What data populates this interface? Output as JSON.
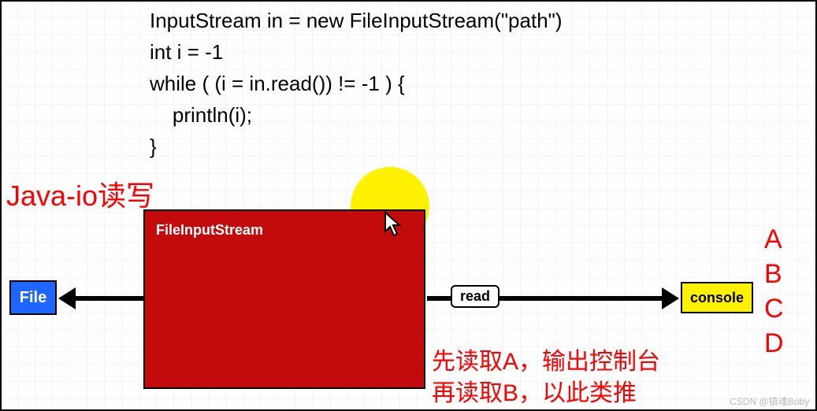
{
  "code": {
    "line1": "InputStream in = new FileInputStream(\"path\")",
    "line2": "int i = -1",
    "line3": "while ( (i = in.read()) != -1 ) {",
    "line4": "    println(i);",
    "line5": "}"
  },
  "annotations": {
    "title": "Java-io读写",
    "note_line1": "先读取A，输出控制台",
    "note_line2": "再读取B，以此类推"
  },
  "boxes": {
    "file": "File",
    "main": "FileInputStream",
    "read": "read",
    "console": "console"
  },
  "output": {
    "l1": "A",
    "l2": "B",
    "l3": "C",
    "l4": "D"
  },
  "watermark": "CSDN @镇魂Boby",
  "colors": {
    "accent_red": "#ff0000",
    "box_red": "#c40b0b",
    "box_blue": "#1e66ff",
    "box_yellow": "#fff200"
  }
}
